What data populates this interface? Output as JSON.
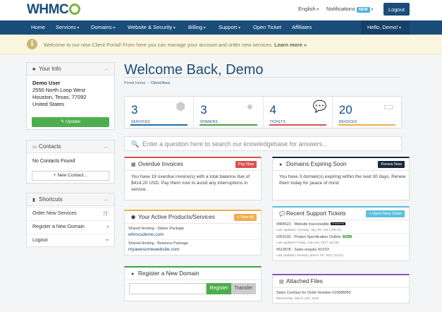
{
  "header": {
    "logo": "WHMCS",
    "language": "English",
    "notifications": "Notifications",
    "notifications_badge": "NEW",
    "logout": "Logout"
  },
  "nav": {
    "items": [
      "Home",
      "Services",
      "Domains",
      "Website & Security",
      "Billing",
      "Support",
      "Open Ticket",
      "Affiliates"
    ],
    "user": "Hello, Demo!"
  },
  "alert": {
    "text": "Welcome to our new Client Portal! From here you can manage your account and order new services.",
    "link": "Learn more »"
  },
  "sidebar": {
    "your_info": {
      "title": "Your Info",
      "name": "Demo User",
      "address1": "2550 North Loop West",
      "address2": "Houston, Texas, 77092",
      "country": "United States",
      "update_label": "Update"
    },
    "contacts": {
      "title": "Contacts",
      "empty_text": "No Contacts Found",
      "new_contact_label": "+ New Contact..."
    },
    "shortcuts": {
      "title": "Shortcuts",
      "items": [
        "Order New Services",
        "Register a New Domain",
        "Logout"
      ]
    }
  },
  "main": {
    "title": "Welcome Back, Demo",
    "breadcrumb": [
      "Portal Home",
      "Client Area"
    ],
    "stats": [
      {
        "value": "3",
        "label": "SERVICES",
        "color": "#1a6fb0",
        "icon": "cube-icon"
      },
      {
        "value": "3",
        "label": "DOMAINS",
        "color": "#43a047",
        "icon": "globe-icon"
      },
      {
        "value": "4",
        "label": "TICKETS",
        "color": "#d9534f",
        "icon": "comments-icon"
      },
      {
        "value": "20",
        "label": "INVOICES",
        "color": "#f0ad4e",
        "icon": "credit-card-icon"
      }
    ],
    "kb_search_placeholder": "Enter a question here to search our knowledgebase for answers...",
    "overdue": {
      "title": "Overdue Invoices",
      "button": "Pay Now",
      "text": "You have 19 overdue invoice(s) with a total balance due of $414.20 USD. Pay them now to avoid any interruptions in service."
    },
    "domains_expiring": {
      "title": "Domains Expiring Soon",
      "button": "Renew Now",
      "text": "You have 3 domain(s) expiring within the next 30 days. Renew them today for peace of mind."
    },
    "products": {
      "title": "Your Active Products/Services",
      "button": "+ View All",
      "items": [
        {
          "package": "Shared Hosting - Starter Package",
          "domain": "whmcsdemo.com"
        },
        {
          "package": "Shared Hosting - Business Package",
          "domain": "myawesomewebsite.com"
        }
      ]
    },
    "tickets": {
      "title": "Recent Support Tickets",
      "button": "+ Open New Ticket",
      "items": [
        {
          "subject": "#884522 - Website Inaccessible",
          "status": "Answered",
          "status_color": "#000000",
          "updated": "Last Updated: Tuesday, July 7th, 2017 (09:12)"
        },
        {
          "subject": "#263102 - Project Specification Outline",
          "status": "Open",
          "status_color": "#5cb85c",
          "updated": "Last Updated: Friday, July 2nd, 2017 (15:35)"
        },
        {
          "subject": "#613978 - Sales enquiry",
          "status": "Closed",
          "status_color": "#bbbbbb",
          "updated": "Last Updated: Monday, March 7th, 2017 (23:41)"
        }
      ]
    },
    "register_domain": {
      "title": "Register a New Domain",
      "register_label": "Register",
      "transfer_label": "Transfer"
    },
    "attached_files": {
      "title": "Attached Files",
      "file": "Sales Contract for Order Number #15688950",
      "date": "Wednesday, March 11th, 2015"
    }
  }
}
